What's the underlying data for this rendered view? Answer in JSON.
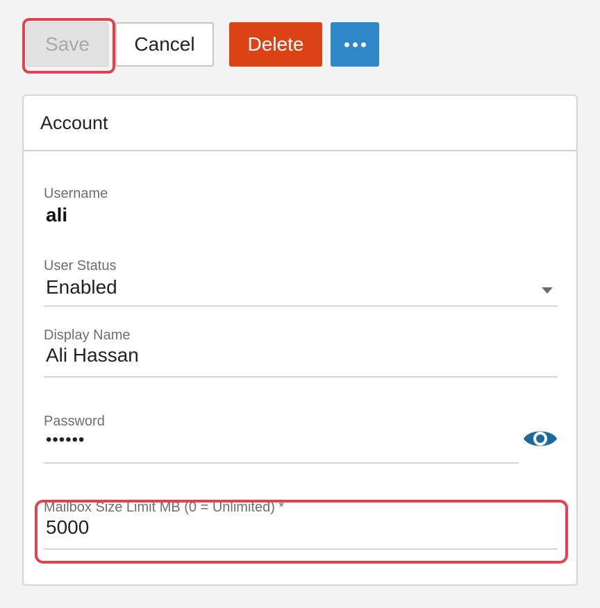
{
  "toolbar": {
    "save_label": "Save",
    "cancel_label": "Cancel",
    "delete_label": "Delete",
    "more_icon": "ellipsis-icon"
  },
  "account": {
    "title": "Account",
    "username": {
      "label": "Username",
      "value": "ali"
    },
    "user_status": {
      "label": "User Status",
      "value": "Enabled"
    },
    "display_name": {
      "label": "Display Name",
      "value": "Ali Hassan"
    },
    "password": {
      "label": "Password",
      "value": "••••••",
      "toggle_icon": "eye-icon"
    },
    "mailbox_limit": {
      "label": "Mailbox Size Limit MB (0 = Unlimited) *",
      "value": "5000"
    }
  },
  "colors": {
    "delete": "#db4216",
    "more": "#2f87c8",
    "highlight": "#e0434f",
    "eye": "#1a6a9a"
  }
}
